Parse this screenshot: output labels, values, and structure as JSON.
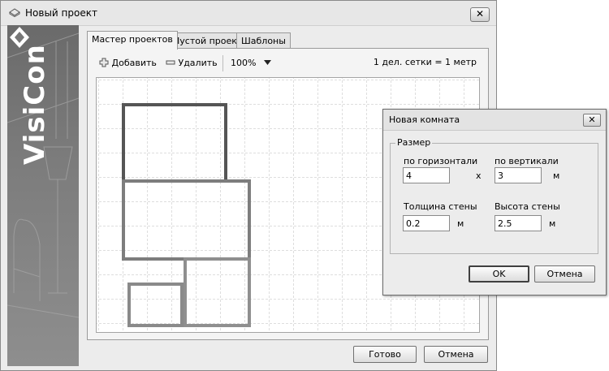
{
  "window": {
    "title": "Новый проект",
    "close_glyph": "✕"
  },
  "sidebar": {
    "logo_text": "VisiCon"
  },
  "tabs": [
    {
      "label": "Мастер проектов",
      "active": true
    },
    {
      "label": "Пустой проект",
      "active": false
    },
    {
      "label": "Шаблоны",
      "active": false
    }
  ],
  "toolbar": {
    "add_label": "Добавить",
    "delete_label": "Удалить",
    "zoom_value": "100%",
    "scale_text": "1 дел. сетки = 1 метр"
  },
  "footer": {
    "done_label": "Готово",
    "cancel_label": "Отмена"
  },
  "dialog": {
    "title": "Новая комната",
    "close_glyph": "✕",
    "group_label": "Размер",
    "horizontal_label": "по горизонтали",
    "vertical_label": "по вертикали",
    "horizontal_value": "4",
    "vertical_value": "3",
    "times_sign": "x",
    "unit_m": "м",
    "wall_thickness_label": "Толщина стены",
    "wall_height_label": "Высота стены",
    "wall_thickness_value": "0.2",
    "wall_height_value": "2.5",
    "ok_label": "OK",
    "cancel_label": "Отмена"
  },
  "colors": {
    "room_dark": "#555555",
    "room_mid": "#7d7d7d",
    "room_light": "#8f8f8f",
    "grid": "#bdbdbd"
  }
}
